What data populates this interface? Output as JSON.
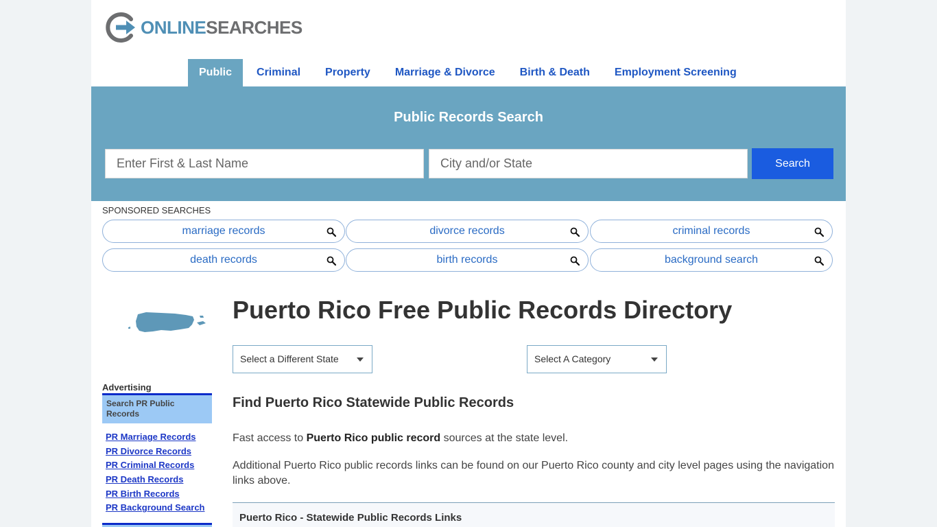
{
  "logo": {
    "part1": "ONLINE",
    "part2": "SEARCHES"
  },
  "nav": {
    "items": [
      {
        "label": "Public"
      },
      {
        "label": "Criminal"
      },
      {
        "label": "Property"
      },
      {
        "label": "Marriage & Divorce"
      },
      {
        "label": "Birth & Death"
      },
      {
        "label": "Employment Screening"
      }
    ],
    "active": "Public"
  },
  "search": {
    "title": "Public Records Search",
    "name_placeholder": "Enter First & Last Name",
    "city_placeholder": "City and/or State",
    "button_label": "Search"
  },
  "sponsored": {
    "label": "SPONSORED SEARCHES",
    "items": [
      {
        "label": "marriage records"
      },
      {
        "label": "divorce records"
      },
      {
        "label": "criminal records"
      },
      {
        "label": "death records"
      },
      {
        "label": "birth records"
      },
      {
        "label": "background search"
      }
    ]
  },
  "sidebar": {
    "advertising_label": "Advertising",
    "box_text": "Search PR Public Records",
    "links": [
      {
        "label": "PR Marriage Records"
      },
      {
        "label": "PR Divorce Records"
      },
      {
        "label": "PR Criminal Records"
      },
      {
        "label": "PR Death Records"
      },
      {
        "label": "PR Birth Records"
      },
      {
        "label": "PR Background Search"
      }
    ]
  },
  "main": {
    "title": "Puerto Rico Free Public Records Directory",
    "state_select": "Select a Different State",
    "category_select": "Select A Category",
    "subtitle": "Find Puerto Rico Statewide Public Records",
    "para1_pre": "Fast access to ",
    "para1_bold": "Puerto Rico public record",
    "para1_post": " sources at the state level.",
    "para2": "Additional Puerto Rico public records links can be found on our Puerto Rico county and city level pages using the navigation links above.",
    "table_header": "Puerto Rico - Statewide Public Records Links"
  },
  "colors": {
    "accent": "#6aa5c1",
    "nav_link": "#1f57c3",
    "search_button": "#1a5ce0",
    "page_bg": "#f0f3f5"
  }
}
